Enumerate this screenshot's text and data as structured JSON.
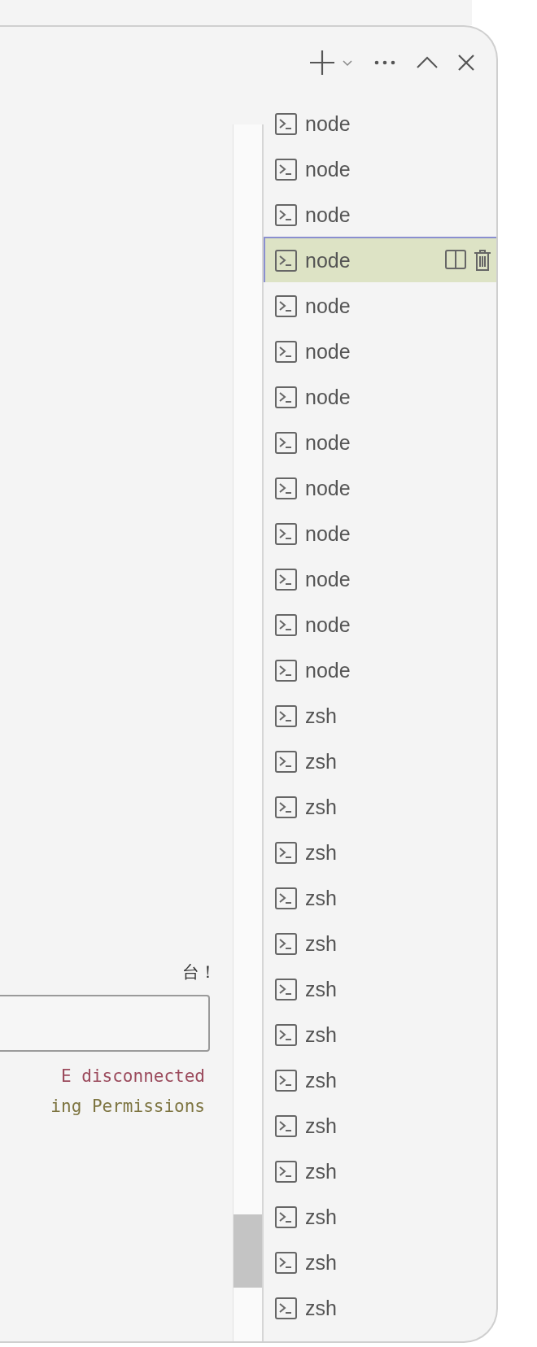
{
  "console": {
    "lines": [
      {
        "text": "台！",
        "kind": "plain"
      }
    ],
    "log": [
      {
        "text": "E disconnected",
        "kind": "error"
      },
      {
        "text": "ing Permissions",
        "kind": "warning"
      }
    ]
  },
  "terminals": [
    {
      "name": "node",
      "selected": false
    },
    {
      "name": "node",
      "selected": false
    },
    {
      "name": "node",
      "selected": false
    },
    {
      "name": "node",
      "selected": true
    },
    {
      "name": "node",
      "selected": false
    },
    {
      "name": "node",
      "selected": false
    },
    {
      "name": "node",
      "selected": false
    },
    {
      "name": "node",
      "selected": false
    },
    {
      "name": "node",
      "selected": false
    },
    {
      "name": "node",
      "selected": false
    },
    {
      "name": "node",
      "selected": false
    },
    {
      "name": "node",
      "selected": false
    },
    {
      "name": "node",
      "selected": false
    },
    {
      "name": "zsh",
      "selected": false
    },
    {
      "name": "zsh",
      "selected": false
    },
    {
      "name": "zsh",
      "selected": false
    },
    {
      "name": "zsh",
      "selected": false
    },
    {
      "name": "zsh",
      "selected": false
    },
    {
      "name": "zsh",
      "selected": false
    },
    {
      "name": "zsh",
      "selected": false
    },
    {
      "name": "zsh",
      "selected": false
    },
    {
      "name": "zsh",
      "selected": false
    },
    {
      "name": "zsh",
      "selected": false
    },
    {
      "name": "zsh",
      "selected": false
    },
    {
      "name": "zsh",
      "selected": false
    },
    {
      "name": "zsh",
      "selected": false
    },
    {
      "name": "zsh",
      "selected": false
    }
  ]
}
